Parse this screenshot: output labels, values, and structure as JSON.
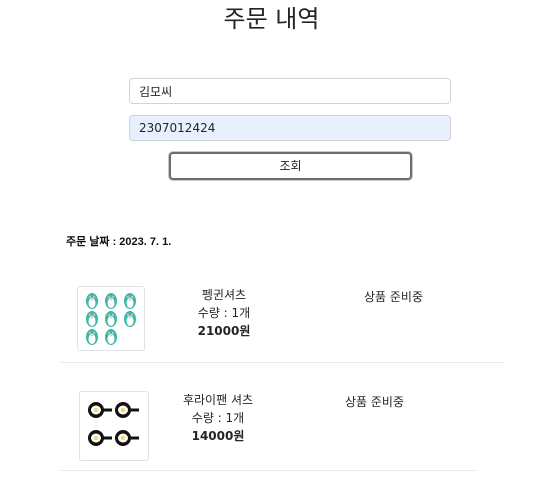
{
  "page": {
    "title": "주문 내역"
  },
  "form": {
    "name_value": "김모씨",
    "phone_value": "2307012424",
    "submit_label": "조회"
  },
  "order": {
    "date_label": "주문 날짜 : 2023. 7. 1.",
    "items": [
      {
        "name": "펭귄셔츠",
        "quantity": "수량 : 1개",
        "price": "21000원",
        "status": "상품 준비중",
        "thumbnail_icon": "penguin-pattern-icon"
      },
      {
        "name": "후라이팬 셔츠",
        "quantity": "수량 : 1개",
        "price": "14000원",
        "status": "상품 준비중",
        "thumbnail_icon": "frying-pan-pattern-icon"
      }
    ]
  },
  "colors": {
    "penguin_teal": "#3fb7a7",
    "autofill_bg": "#e8f0fe",
    "pan_black": "#111111",
    "egg_yolk": "#f5d76e"
  }
}
